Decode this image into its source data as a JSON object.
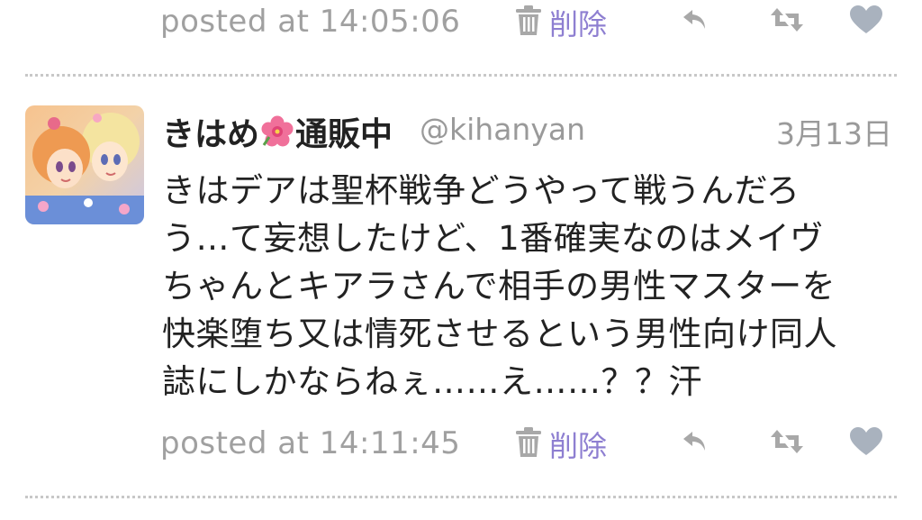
{
  "colors": {
    "meta_text": "#a0a0a0",
    "delete_accent": "#8e7fd1",
    "icon_gray": "#a8a8a8",
    "heart_gray": "#a9b2be",
    "divider": "#c8c8c8",
    "body_text": "#222222"
  },
  "tweets": [
    {
      "posted_label": "posted at 14:05:06",
      "delete_label": "削除",
      "icons": [
        "trash-icon",
        "reply-icon",
        "retweet-icon",
        "heart-icon"
      ]
    },
    {
      "author": {
        "name_part1": "きはめ",
        "name_emoji_icon": "hibiscus-flower-icon",
        "name_part2": "通販中",
        "handle": "@kihanyan",
        "avatar_icon": "anime-girls-avatar"
      },
      "date": "3月13日",
      "text_lines": [
        "きはデアは聖杯戦争どうやって戦うんだろ",
        "う…て妄想したけど、1番確実なのはメイヴ",
        "ちゃんとキアラさんで相手の男性マスターを",
        "快楽堕ち又は情死させるという男性向け同人",
        "誌にしかならねぇ……え……？？汗"
      ],
      "posted_label": "posted at 14:11:45",
      "delete_label": "削除",
      "icons": [
        "trash-icon",
        "reply-icon",
        "retweet-icon",
        "heart-icon"
      ]
    }
  ]
}
